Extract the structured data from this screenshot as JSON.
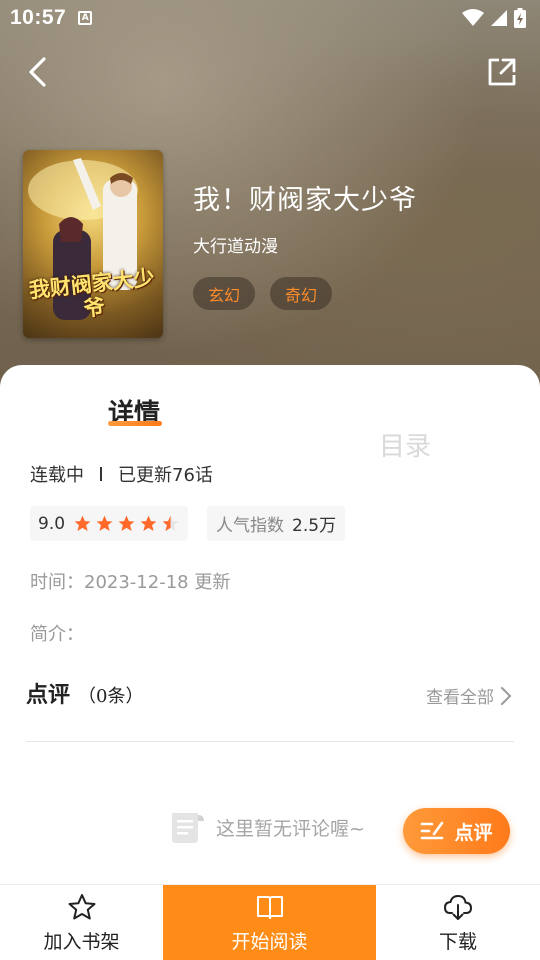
{
  "status_bar": {
    "time": "10:57",
    "app_icon_letter": "A"
  },
  "nav": {
    "back_icon": "chevron-left-icon",
    "share_icon": "share-icon"
  },
  "book": {
    "cover_title": "我财阀家大少爷",
    "title": "我！财阀家大少爷",
    "author": "大行道动漫",
    "tags": [
      "玄幻",
      "奇幻"
    ]
  },
  "tabs": {
    "detail": "详情",
    "catalog": "目录",
    "active": "detail"
  },
  "info": {
    "serial_status": "连载中",
    "updated": "已更新76话",
    "rating": "9.0",
    "rating_stars": 4.5,
    "popularity_label": "人气指数",
    "popularity_value": "2.5万",
    "time": "时间：2023-12-18 更新",
    "intro_label": "简介："
  },
  "reviews": {
    "title": "点评",
    "count": "（0条）",
    "view_all": "查看全部",
    "empty_text": "这里暂无评论喔~",
    "comment_button": "点评"
  },
  "bottom_bar": {
    "add_shelf": "加入书架",
    "start_reading": "开始阅读",
    "download": "下载"
  },
  "colors": {
    "accent": "#ff8c17",
    "star": "#ff6a2b",
    "tag_text": "#ff8c2a",
    "catalog_inactive": "#d9d9d9"
  }
}
